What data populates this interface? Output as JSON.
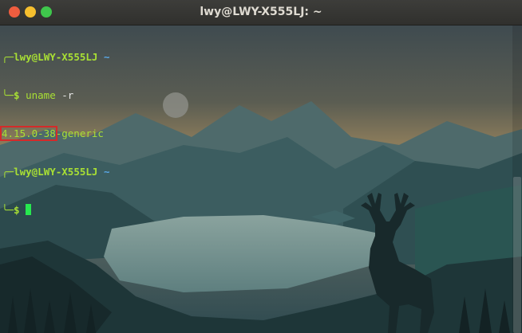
{
  "window": {
    "title": "lwy@LWY-X555LJ: ~"
  },
  "terminal": {
    "lines": [
      {
        "prompt_top": "╭─",
        "user_host": "lwy@LWY-X555LJ",
        "dir": "~"
      },
      {
        "prompt_bottom": "╰─$ ",
        "command": "uname",
        "args": " -r"
      },
      {
        "output_highlight": "4.15.0-38",
        "output_rest": "-generic"
      },
      {
        "prompt_top": "╭─",
        "user_host": "lwy@LWY-X555LJ",
        "dir": "~"
      },
      {
        "prompt_bottom": "╰─$ "
      }
    ]
  },
  "colors": {
    "prompt": "#a9e034",
    "directory": "#59a7e6",
    "cursor": "#27e84f",
    "highlight_box": "#d52a2a"
  }
}
